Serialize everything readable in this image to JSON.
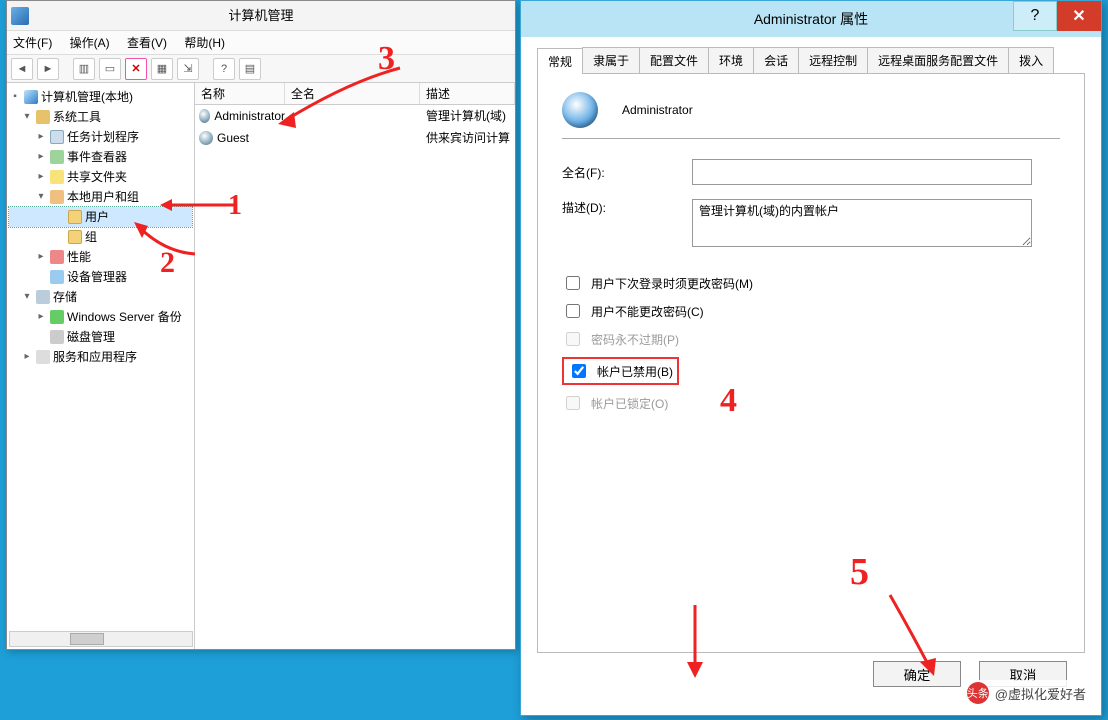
{
  "mgmt": {
    "title": "计算机管理",
    "menus": {
      "file": "文件(F)",
      "action": "操作(A)",
      "view": "查看(V)",
      "help": "帮助(H)"
    },
    "tree": {
      "root": "计算机管理(本地)",
      "system_tools": "系统工具",
      "task_scheduler": "任务计划程序",
      "event_viewer": "事件查看器",
      "shared_folders": "共享文件夹",
      "local_users_groups": "本地用户和组",
      "users": "用户",
      "groups": "组",
      "performance": "性能",
      "device_manager": "设备管理器",
      "storage": "存储",
      "windows_server": "Windows Server 备份",
      "disk_mgmt": "磁盘管理",
      "services_apps": "服务和应用程序"
    },
    "columns": {
      "name": "名称",
      "fullname": "全名",
      "desc": "描述"
    },
    "users_list": [
      {
        "name": "Administrator",
        "fullname": "",
        "desc": "管理计算机(域)的内置帐户"
      },
      {
        "name": "Guest",
        "fullname": "",
        "desc": "供来宾访问计算机或访问域的内置帐户"
      }
    ]
  },
  "dlg": {
    "title": "Administrator 属性",
    "tabs": [
      "常规",
      "隶属于",
      "配置文件",
      "环境",
      "会话",
      "远程控制",
      "远程桌面服务配置文件",
      "拨入"
    ],
    "active_tab": 0,
    "username": "Administrator",
    "fullname_label": "全名(F):",
    "fullname_value": "",
    "desc_label": "描述(D):",
    "desc_value": "管理计算机(域)的内置帐户",
    "checks": {
      "must_change": {
        "label": "用户下次登录时须更改密码(M)",
        "checked": false,
        "disabled": false
      },
      "cannot_change": {
        "label": "用户不能更改密码(C)",
        "checked": false,
        "disabled": false
      },
      "never_expire": {
        "label": "密码永不过期(P)",
        "checked": false,
        "disabled": true
      },
      "disabled_acct": {
        "label": "帐户已禁用(B)",
        "checked": true,
        "disabled": false
      },
      "locked": {
        "label": "帐户已锁定(O)",
        "checked": false,
        "disabled": true
      }
    },
    "buttons": {
      "ok": "确定",
      "cancel": "取消"
    }
  },
  "annotations": {
    "a1": "1",
    "a2": "2",
    "a3": "3",
    "a4": "4",
    "a5": "5"
  },
  "watermark": {
    "prefix": "头条",
    "text": "@虚拟化爱好者"
  }
}
